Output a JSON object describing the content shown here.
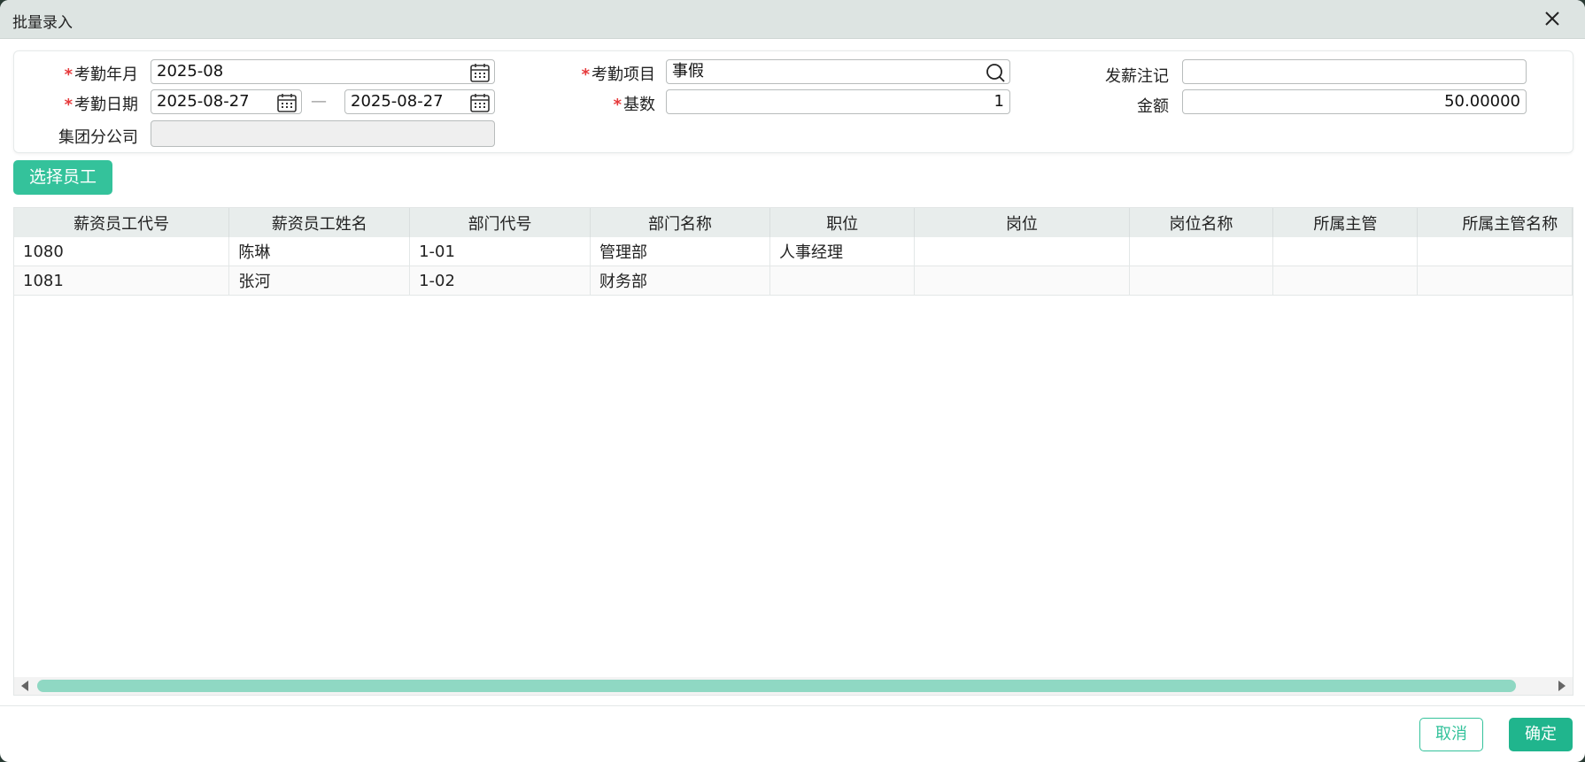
{
  "dialog": {
    "title": "批量录入"
  },
  "form": {
    "attendance_month": {
      "label": "考勤年月",
      "required_mark": "*",
      "value": "2025-08"
    },
    "attendance_date": {
      "label": "考勤日期",
      "required_mark": "*",
      "start": "2025-08-27",
      "separator": "—",
      "end": "2025-08-27"
    },
    "group_branch": {
      "label": "集团分公司",
      "value": ""
    },
    "attendance_item": {
      "label": "考勤项目",
      "required_mark": "*",
      "value": "事假"
    },
    "base_count": {
      "label": "基数",
      "required_mark": "*",
      "value": "1"
    },
    "pay_note": {
      "label": "发薪注记",
      "value": ""
    },
    "amount": {
      "label": "金额",
      "value": "50.00000"
    }
  },
  "toolbar": {
    "select_employee": "选择员工"
  },
  "grid": {
    "columns": [
      "薪资员工代号",
      "薪资员工姓名",
      "部门代号",
      "部门名称",
      "职位",
      "岗位",
      "岗位名称",
      "所属主管",
      "所属主管名称"
    ],
    "rows": [
      [
        "1080",
        "陈琳",
        "1-01",
        "管理部",
        "人事经理",
        "",
        "",
        "",
        ""
      ],
      [
        "1081",
        "张河",
        "1-02",
        "财务部",
        "",
        "",
        "",
        "",
        ""
      ]
    ]
  },
  "footer": {
    "cancel": "取消",
    "confirm": "确定"
  },
  "colors": {
    "accent": "#20b58d",
    "select_button": "#34c29b",
    "required": "#e6393b",
    "scroll_thumb": "#8fd8c3"
  },
  "icons": [
    "close-icon",
    "calendar-icon",
    "search-icon"
  ]
}
